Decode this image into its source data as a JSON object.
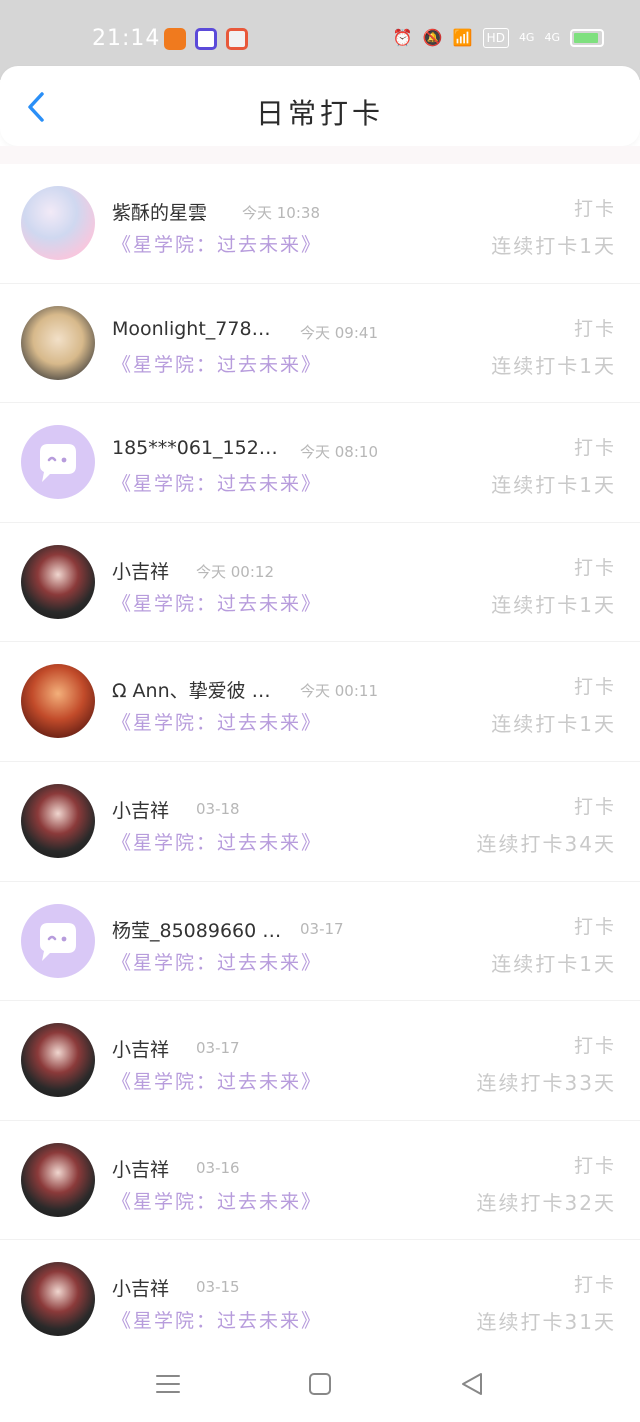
{
  "status_bar": {
    "time": "21:14",
    "network_badge": "HD",
    "signal1": "4G",
    "signal2": "4G",
    "battery_color": "#7fe07f",
    "icons": [
      "alarm-icon",
      "mute-icon",
      "wifi-icon",
      "hd-icon",
      "signal-icon",
      "signal-icon",
      "battery-icon"
    ]
  },
  "header": {
    "title": "日常打卡",
    "back_icon": "chevron-left-icon",
    "back_color": "#2a8ff7"
  },
  "rows": [
    {
      "name": "紫酥的星雲",
      "time": "今天 10:38",
      "course": "《星学院：过去未来》",
      "action": "打卡",
      "streak": "连续打卡1天",
      "avatar": "anime1"
    },
    {
      "name": "Moonlight_7780 …",
      "time": "今天 09:41",
      "course": "《星学院：过去未来》",
      "action": "打卡",
      "streak": "连续打卡1天",
      "avatar": "blonde"
    },
    {
      "name": "185***061_152 …",
      "time": "今天 08:10",
      "course": "《星学院：过去未来》",
      "action": "打卡",
      "streak": "连续打卡1天",
      "avatar": "default"
    },
    {
      "name": "小吉祥",
      "time": "今天 00:12",
      "course": "《星学院：过去未来》",
      "action": "打卡",
      "streak": "连续打卡1天",
      "avatar": "dark"
    },
    {
      "name": "Ω Ann、挚爱彼 …",
      "time": "今天 00:11",
      "course": "《星学院：过去未来》",
      "action": "打卡",
      "streak": "连续打卡1天",
      "avatar": "red"
    },
    {
      "name": "小吉祥",
      "time": "03-18",
      "course": "《星学院：过去未来》",
      "action": "打卡",
      "streak": "连续打卡34天",
      "avatar": "dark"
    },
    {
      "name": "杨莹_85089660 …",
      "time": "03-17",
      "course": "《星学院：过去未来》",
      "action": "打卡",
      "streak": "连续打卡1天",
      "avatar": "default"
    },
    {
      "name": "小吉祥",
      "time": "03-17",
      "course": "《星学院：过去未来》",
      "action": "打卡",
      "streak": "连续打卡33天",
      "avatar": "dark"
    },
    {
      "name": "小吉祥",
      "time": "03-16",
      "course": "《星学院：过去未来》",
      "action": "打卡",
      "streak": "连续打卡32天",
      "avatar": "dark"
    },
    {
      "name": "小吉祥",
      "time": "03-15",
      "course": "《星学院：过去未来》",
      "action": "打卡",
      "streak": "连续打卡31天",
      "avatar": "dark"
    }
  ],
  "nav": {
    "icons": [
      "menu-icon",
      "home-square-icon",
      "back-triangle-icon"
    ]
  }
}
